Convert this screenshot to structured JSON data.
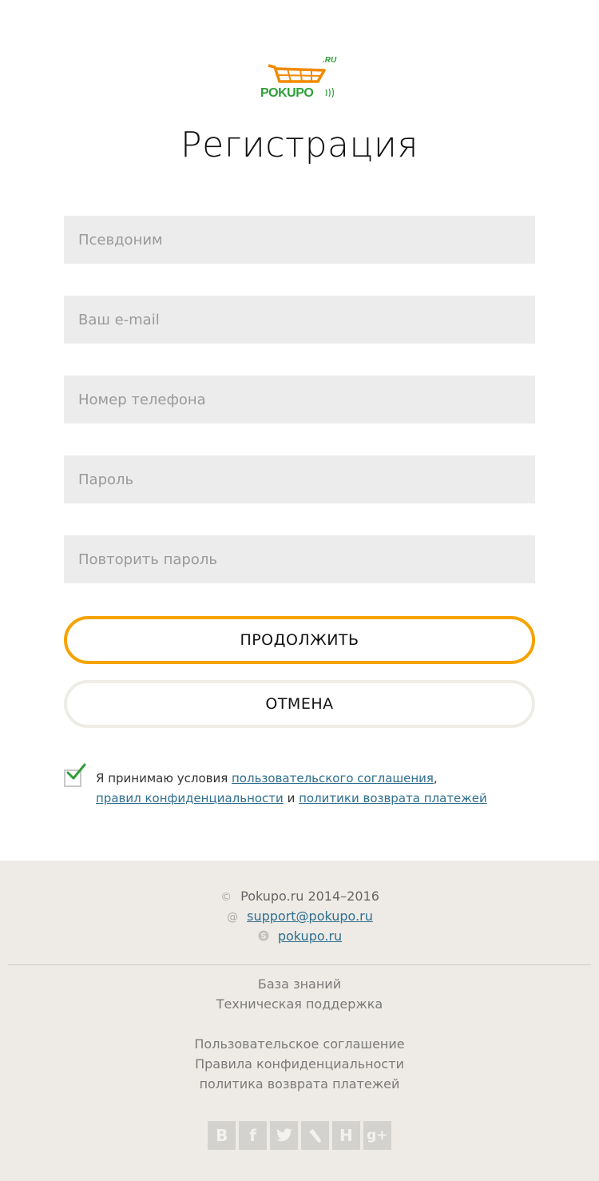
{
  "logo": {
    "brand": "POKUPO",
    "domain": ".RU"
  },
  "page_title": "Регистрация",
  "form": {
    "nickname": {
      "placeholder": "Псевдоним",
      "value": ""
    },
    "email": {
      "placeholder": "Ваш e-mail",
      "value": ""
    },
    "phone": {
      "placeholder": "Номер телефона",
      "value": ""
    },
    "password": {
      "placeholder": "Пароль",
      "value": ""
    },
    "password_repeat": {
      "placeholder": "Повторить пароль",
      "value": ""
    },
    "continue_label": "ПРОДОЛЖИТЬ",
    "cancel_label": "ОТМЕНА"
  },
  "agreement": {
    "checked": true,
    "prefix": "Я принимаю условия ",
    "link_user_agreement": "пользовательского соглашения",
    "comma": ",",
    "link_privacy": "правил конфиденциальности",
    "and": " и ",
    "link_refund": "политики возврата платежей"
  },
  "footer": {
    "copyright_symbol": "©",
    "copyright": "Pokupo.ru 2014–2016",
    "email_symbol": "@",
    "email": "support@pokupo.ru",
    "skype": "pokupo.ru",
    "links_group1": [
      "База знаний",
      "Техническая поддержка"
    ],
    "links_group2": [
      "Пользовательское соглашение",
      "Правила конфиденциальности",
      "политика возврата платежей"
    ],
    "social": [
      {
        "icon": "vk-icon",
        "glyph": "В"
      },
      {
        "icon": "facebook-icon",
        "glyph": "f"
      },
      {
        "icon": "twitter-icon",
        "glyph": ""
      },
      {
        "icon": "livejournal-icon",
        "glyph": ""
      },
      {
        "icon": "habr-icon",
        "glyph": "H"
      },
      {
        "icon": "google-plus-icon",
        "glyph": "g+"
      }
    ]
  },
  "colors": {
    "accent": "#f5a300",
    "link": "#2f6f8f",
    "field_bg": "#ececec",
    "footer_bg": "#eeebe6",
    "logo_green": "#2e9e3a",
    "logo_orange": "#f08a00"
  }
}
